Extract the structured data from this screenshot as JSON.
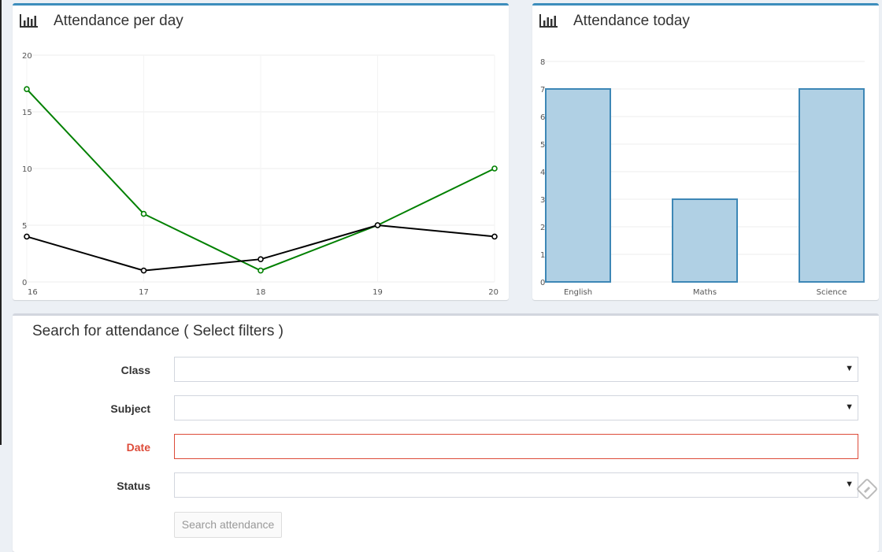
{
  "left_panel": {
    "title": "Attendance per day"
  },
  "right_panel": {
    "title": "Attendance today"
  },
  "chart_data": [
    {
      "type": "line",
      "title": "Attendance per day",
      "x": [
        16,
        17,
        18,
        19,
        20
      ],
      "ylim": [
        0,
        20
      ],
      "yticks": [
        0,
        5,
        10,
        15,
        20
      ],
      "series": [
        {
          "values": [
            17,
            6,
            1,
            5,
            10
          ],
          "color": "#008000"
        },
        {
          "values": [
            4,
            1,
            2,
            5,
            4
          ],
          "color": "#000000"
        }
      ],
      "grid": true
    },
    {
      "type": "bar",
      "title": "Attendance today",
      "categories": [
        "English",
        "Maths",
        "Science"
      ],
      "values": [
        7,
        3,
        7
      ],
      "ylim": [
        0,
        8
      ],
      "yticks": [
        0,
        1,
        2,
        3,
        4,
        5,
        6,
        7,
        8
      ],
      "bar_fill": "#b0d0e4",
      "bar_stroke": "#3d87b6",
      "grid": true
    }
  ],
  "search_form": {
    "title": "Search for attendance ( Select filters )",
    "class_label": "Class",
    "subject_label": "Subject",
    "date_label": "Date",
    "status_label": "Status",
    "caret": "▼",
    "submit_label": "Search attendance"
  },
  "colors": {
    "accent": "#3c8dbc",
    "error": "#dd4b39"
  },
  "icons": {
    "panel_icon": "bar-chart-icon",
    "floating_icon": "edit-icon"
  }
}
